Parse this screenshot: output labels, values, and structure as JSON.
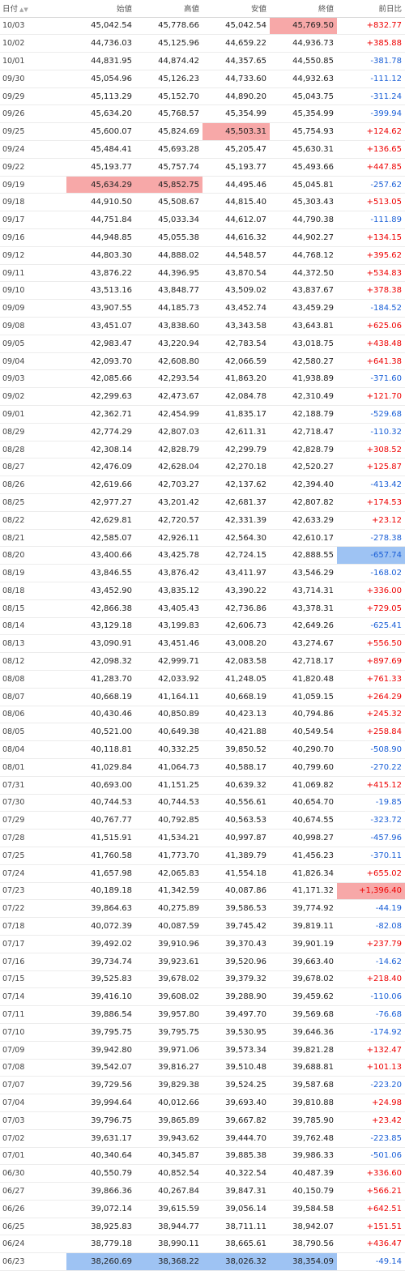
{
  "headers": [
    "日付",
    "始値",
    "高値",
    "安値",
    "終値",
    "前日比"
  ],
  "colors": {
    "up": "#e00000",
    "down": "#1a5fd6",
    "highlight_high": "#f7a8a8",
    "highlight_low": "#9ec3f3"
  },
  "rows": [
    [
      "10/03",
      "45,042.54",
      "45,778.66",
      "45,042.54",
      "45,769.50",
      "+832.77"
    ],
    [
      "10/02",
      "44,736.03",
      "45,125.96",
      "44,659.22",
      "44,936.73",
      "+385.88"
    ],
    [
      "10/01",
      "44,831.95",
      "44,874.42",
      "44,357.65",
      "44,550.85",
      "-381.78"
    ],
    [
      "09/30",
      "45,054.96",
      "45,126.23",
      "44,733.60",
      "44,932.63",
      "-111.12"
    ],
    [
      "09/29",
      "45,113.29",
      "45,152.70",
      "44,890.20",
      "45,043.75",
      "-311.24"
    ],
    [
      "09/26",
      "45,634.20",
      "45,768.57",
      "45,354.99",
      "45,354.99",
      "-399.94"
    ],
    [
      "09/25",
      "45,600.07",
      "45,824.69",
      "45,503.31",
      "45,754.93",
      "+124.62"
    ],
    [
      "09/24",
      "45,484.41",
      "45,693.28",
      "45,205.47",
      "45,630.31",
      "+136.65"
    ],
    [
      "09/22",
      "45,193.77",
      "45,757.74",
      "45,193.77",
      "45,493.66",
      "+447.85"
    ],
    [
      "09/19",
      "45,634.29",
      "45,852.75",
      "44,495.46",
      "45,045.81",
      "-257.62"
    ],
    [
      "09/18",
      "44,910.50",
      "45,508.67",
      "44,815.40",
      "45,303.43",
      "+513.05"
    ],
    [
      "09/17",
      "44,751.84",
      "45,033.34",
      "44,612.07",
      "44,790.38",
      "-111.89"
    ],
    [
      "09/16",
      "44,948.85",
      "45,055.38",
      "44,616.32",
      "44,902.27",
      "+134.15"
    ],
    [
      "09/12",
      "44,803.30",
      "44,888.02",
      "44,548.57",
      "44,768.12",
      "+395.62"
    ],
    [
      "09/11",
      "43,876.22",
      "44,396.95",
      "43,870.54",
      "44,372.50",
      "+534.83"
    ],
    [
      "09/10",
      "43,513.16",
      "43,848.77",
      "43,509.02",
      "43,837.67",
      "+378.38"
    ],
    [
      "09/09",
      "43,907.55",
      "44,185.73",
      "43,452.74",
      "43,459.29",
      "-184.52"
    ],
    [
      "09/08",
      "43,451.07",
      "43,838.60",
      "43,343.58",
      "43,643.81",
      "+625.06"
    ],
    [
      "09/05",
      "42,983.47",
      "43,220.94",
      "42,783.54",
      "43,018.75",
      "+438.48"
    ],
    [
      "09/04",
      "42,093.70",
      "42,608.80",
      "42,066.59",
      "42,580.27",
      "+641.38"
    ],
    [
      "09/03",
      "42,085.66",
      "42,293.54",
      "41,863.20",
      "41,938.89",
      "-371.60"
    ],
    [
      "09/02",
      "42,299.63",
      "42,473.67",
      "42,084.78",
      "42,310.49",
      "+121.70"
    ],
    [
      "09/01",
      "42,362.71",
      "42,454.99",
      "41,835.17",
      "42,188.79",
      "-529.68"
    ],
    [
      "08/29",
      "42,774.29",
      "42,807.03",
      "42,611.31",
      "42,718.47",
      "-110.32"
    ],
    [
      "08/28",
      "42,308.14",
      "42,828.79",
      "42,299.79",
      "42,828.79",
      "+308.52"
    ],
    [
      "08/27",
      "42,476.09",
      "42,628.04",
      "42,270.18",
      "42,520.27",
      "+125.87"
    ],
    [
      "08/26",
      "42,619.66",
      "42,703.27",
      "42,137.62",
      "42,394.40",
      "-413.42"
    ],
    [
      "08/25",
      "42,977.27",
      "43,201.42",
      "42,681.37",
      "42,807.82",
      "+174.53"
    ],
    [
      "08/22",
      "42,629.81",
      "42,720.57",
      "42,331.39",
      "42,633.29",
      "+23.12"
    ],
    [
      "08/21",
      "42,585.07",
      "42,926.11",
      "42,564.30",
      "42,610.17",
      "-278.38"
    ],
    [
      "08/20",
      "43,400.66",
      "43,425.78",
      "42,724.15",
      "42,888.55",
      "-657.74"
    ],
    [
      "08/19",
      "43,846.55",
      "43,876.42",
      "43,411.97",
      "43,546.29",
      "-168.02"
    ],
    [
      "08/18",
      "43,452.90",
      "43,835.12",
      "43,390.22",
      "43,714.31",
      "+336.00"
    ],
    [
      "08/15",
      "42,866.38",
      "43,405.43",
      "42,736.86",
      "43,378.31",
      "+729.05"
    ],
    [
      "08/14",
      "43,129.18",
      "43,199.83",
      "42,606.73",
      "42,649.26",
      "-625.41"
    ],
    [
      "08/13",
      "43,090.91",
      "43,451.46",
      "43,008.20",
      "43,274.67",
      "+556.50"
    ],
    [
      "08/12",
      "42,098.32",
      "42,999.71",
      "42,083.58",
      "42,718.17",
      "+897.69"
    ],
    [
      "08/08",
      "41,283.70",
      "42,033.92",
      "41,248.05",
      "41,820.48",
      "+761.33"
    ],
    [
      "08/07",
      "40,668.19",
      "41,164.11",
      "40,668.19",
      "41,059.15",
      "+264.29"
    ],
    [
      "08/06",
      "40,430.46",
      "40,850.89",
      "40,423.13",
      "40,794.86",
      "+245.32"
    ],
    [
      "08/05",
      "40,521.00",
      "40,649.38",
      "40,421.88",
      "40,549.54",
      "+258.84"
    ],
    [
      "08/04",
      "40,118.81",
      "40,332.25",
      "39,850.52",
      "40,290.70",
      "-508.90"
    ],
    [
      "08/01",
      "41,029.84",
      "41,064.73",
      "40,588.17",
      "40,799.60",
      "-270.22"
    ],
    [
      "07/31",
      "40,693.00",
      "41,151.25",
      "40,639.32",
      "41,069.82",
      "+415.12"
    ],
    [
      "07/30",
      "40,744.53",
      "40,744.53",
      "40,556.61",
      "40,654.70",
      "-19.85"
    ],
    [
      "07/29",
      "40,767.77",
      "40,792.85",
      "40,563.53",
      "40,674.55",
      "-323.72"
    ],
    [
      "07/28",
      "41,515.91",
      "41,534.21",
      "40,997.87",
      "40,998.27",
      "-457.96"
    ],
    [
      "07/25",
      "41,760.58",
      "41,773.70",
      "41,389.79",
      "41,456.23",
      "-370.11"
    ],
    [
      "07/24",
      "41,657.98",
      "42,065.83",
      "41,554.18",
      "41,826.34",
      "+655.02"
    ],
    [
      "07/23",
      "40,189.18",
      "41,342.59",
      "40,087.86",
      "41,171.32",
      "+1,396.40"
    ],
    [
      "07/22",
      "39,864.63",
      "40,275.89",
      "39,586.53",
      "39,774.92",
      "-44.19"
    ],
    [
      "07/18",
      "40,072.39",
      "40,087.59",
      "39,745.42",
      "39,819.11",
      "-82.08"
    ],
    [
      "07/17",
      "39,492.02",
      "39,910.96",
      "39,370.43",
      "39,901.19",
      "+237.79"
    ],
    [
      "07/16",
      "39,734.74",
      "39,923.61",
      "39,520.96",
      "39,663.40",
      "-14.62"
    ],
    [
      "07/15",
      "39,525.83",
      "39,678.02",
      "39,379.32",
      "39,678.02",
      "+218.40"
    ],
    [
      "07/14",
      "39,416.10",
      "39,608.02",
      "39,288.90",
      "39,459.62",
      "-110.06"
    ],
    [
      "07/11",
      "39,886.54",
      "39,957.80",
      "39,497.70",
      "39,569.68",
      "-76.68"
    ],
    [
      "07/10",
      "39,795.75",
      "39,795.75",
      "39,530.95",
      "39,646.36",
      "-174.92"
    ],
    [
      "07/09",
      "39,942.80",
      "39,971.06",
      "39,573.34",
      "39,821.28",
      "+132.47"
    ],
    [
      "07/08",
      "39,542.07",
      "39,816.27",
      "39,510.48",
      "39,688.81",
      "+101.13"
    ],
    [
      "07/07",
      "39,729.56",
      "39,829.38",
      "39,524.25",
      "39,587.68",
      "-223.20"
    ],
    [
      "07/04",
      "39,994.64",
      "40,012.66",
      "39,693.40",
      "39,810.88",
      "+24.98"
    ],
    [
      "07/03",
      "39,796.75",
      "39,865.89",
      "39,667.82",
      "39,785.90",
      "+23.42"
    ],
    [
      "07/02",
      "39,631.17",
      "39,943.62",
      "39,444.70",
      "39,762.48",
      "-223.85"
    ],
    [
      "07/01",
      "40,340.64",
      "40,345.87",
      "39,885.38",
      "39,986.33",
      "-501.06"
    ],
    [
      "06/30",
      "40,550.79",
      "40,852.54",
      "40,322.54",
      "40,487.39",
      "+336.60"
    ],
    [
      "06/27",
      "39,866.36",
      "40,267.84",
      "39,847.31",
      "40,150.79",
      "+566.21"
    ],
    [
      "06/26",
      "39,072.14",
      "39,615.59",
      "39,056.14",
      "39,584.58",
      "+642.51"
    ],
    [
      "06/25",
      "38,925.83",
      "38,944.77",
      "38,711.11",
      "38,942.07",
      "+151.51"
    ],
    [
      "06/24",
      "38,779.18",
      "38,990.11",
      "38,665.61",
      "38,790.56",
      "+436.47"
    ],
    [
      "06/23",
      "38,260.69",
      "38,368.22",
      "38,026.32",
      "38,354.09",
      "-49.14"
    ]
  ],
  "highlights_high": [
    [
      0,
      4
    ],
    [
      6,
      3
    ],
    [
      9,
      1
    ],
    [
      9,
      2
    ],
    [
      49,
      5
    ]
  ],
  "highlights_low": [
    [
      30,
      5
    ],
    [
      70,
      1
    ],
    [
      70,
      2
    ],
    [
      70,
      3
    ],
    [
      70,
      4
    ]
  ]
}
